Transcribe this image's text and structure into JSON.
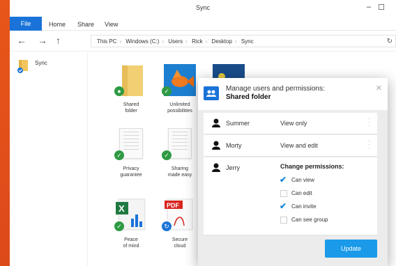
{
  "window": {
    "title": "Sync"
  },
  "ribbon": {
    "file": "File",
    "tabs": [
      "Home",
      "Share",
      "View"
    ]
  },
  "address": {
    "crumbs": [
      "This PC",
      "Windows (C:)",
      "Users",
      "Rick",
      "Desktop",
      "Sync"
    ]
  },
  "sidebar": {
    "items": [
      {
        "label": "Sync"
      }
    ]
  },
  "files": [
    {
      "caption": "Shared\nfolder"
    },
    {
      "caption": "Unlimited\npossibilities"
    },
    {
      "caption": "Privacy\nguarantee"
    },
    {
      "caption": "Sharing\nmade easy"
    },
    {
      "caption": "Peace\nof mind"
    },
    {
      "caption": "Secure\ncloud"
    }
  ],
  "dialog": {
    "title": "Manage users and permissions:",
    "subtitle": "Shared folder",
    "users": [
      {
        "name": "Summer",
        "permission": "View only"
      },
      {
        "name": "Morty",
        "permission": "View and edit"
      },
      {
        "name": "Jerry",
        "permission_title": "Change permissions:"
      }
    ],
    "options": [
      {
        "label": "Can view",
        "checked": true
      },
      {
        "label": "Can edit",
        "checked": false
      },
      {
        "label": "Can invite",
        "checked": true
      },
      {
        "label": "Can see group",
        "checked": false
      }
    ],
    "update_label": "Update"
  },
  "colors": {
    "accent": "#1a73d8",
    "update_button": "#1a9ae8",
    "sync_badge": "#2e9a43"
  }
}
